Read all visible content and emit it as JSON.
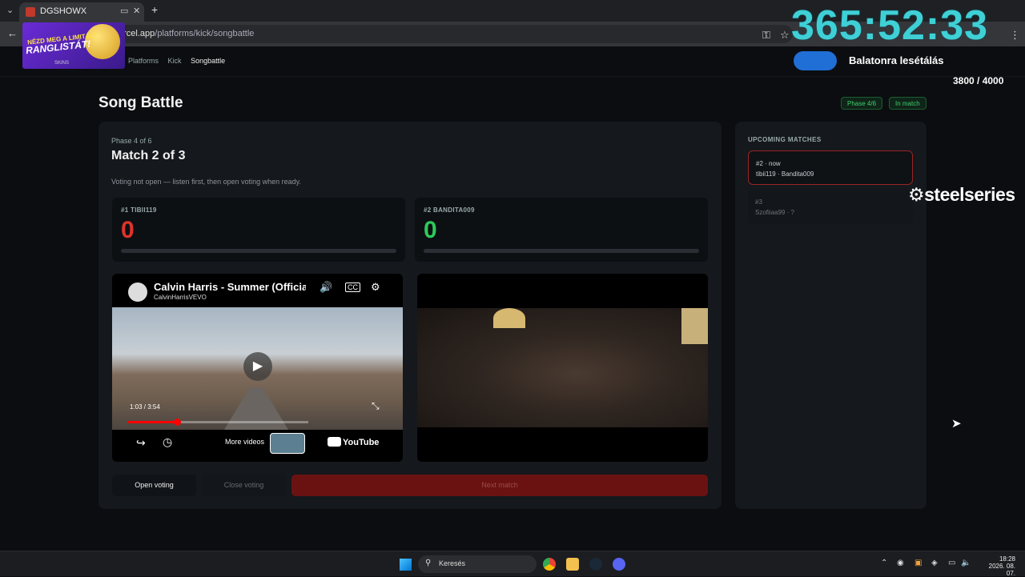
{
  "browser": {
    "tab_title": "DGSHOWX",
    "url_host": "ercel.app",
    "url_path": "/platforms/kick/songbattle",
    "new_tab_icon": "+",
    "tab_menu_icon": "⌄",
    "back_icon": "←"
  },
  "promo": {
    "line1": "NÉZD MEG A LIMITÁLT",
    "line2": "RANGLISTÁT!",
    "brand": "SKINS"
  },
  "overlay": {
    "timer": "365:52:33",
    "goal_title": "Balatonra lesétálás",
    "goal_count": "3800 / 4000",
    "goal_progress": 0.95,
    "sponsor": "⚙steelseries"
  },
  "nav": {
    "crumbs": [
      "Platforms",
      "Kick",
      "Songbattle"
    ]
  },
  "page": {
    "title": "Song Battle",
    "badge_phase": "Phase 4/6",
    "badge_status": "In match"
  },
  "match": {
    "phase_label": "Phase 4 of 6",
    "match_label": "Match 2 of 3",
    "voting_message": "Voting not open — listen first, then open voting when ready.",
    "contestants": [
      {
        "name": "#1 TIBII119",
        "score": "0",
        "color": "#e0332b",
        "share": 0
      },
      {
        "name": "#2 BANDITA009",
        "score": "0",
        "color": "#2fc95a",
        "share": 0
      }
    ]
  },
  "youtube": {
    "title": "Calvin Harris - Summer (Official",
    "channel": "CalvinHarrisVEVO",
    "time": "1:03 / 3:54",
    "progress": 0.27,
    "more_videos": "More videos",
    "logo": "YouTube"
  },
  "controls": {
    "open_voting": "Open voting",
    "close_voting": "Close voting",
    "next_match": "Next match"
  },
  "upcoming": {
    "header": "UPCOMING MATCHES",
    "items": [
      {
        "label": "#2 · now",
        "players": "tibii119 · Bandita009"
      },
      {
        "label": "#3",
        "players": "Szofiiaa99 · ?"
      }
    ]
  },
  "taskbar": {
    "search": "Keresés",
    "time": "18:28",
    "date": "2026. 08. 07."
  }
}
